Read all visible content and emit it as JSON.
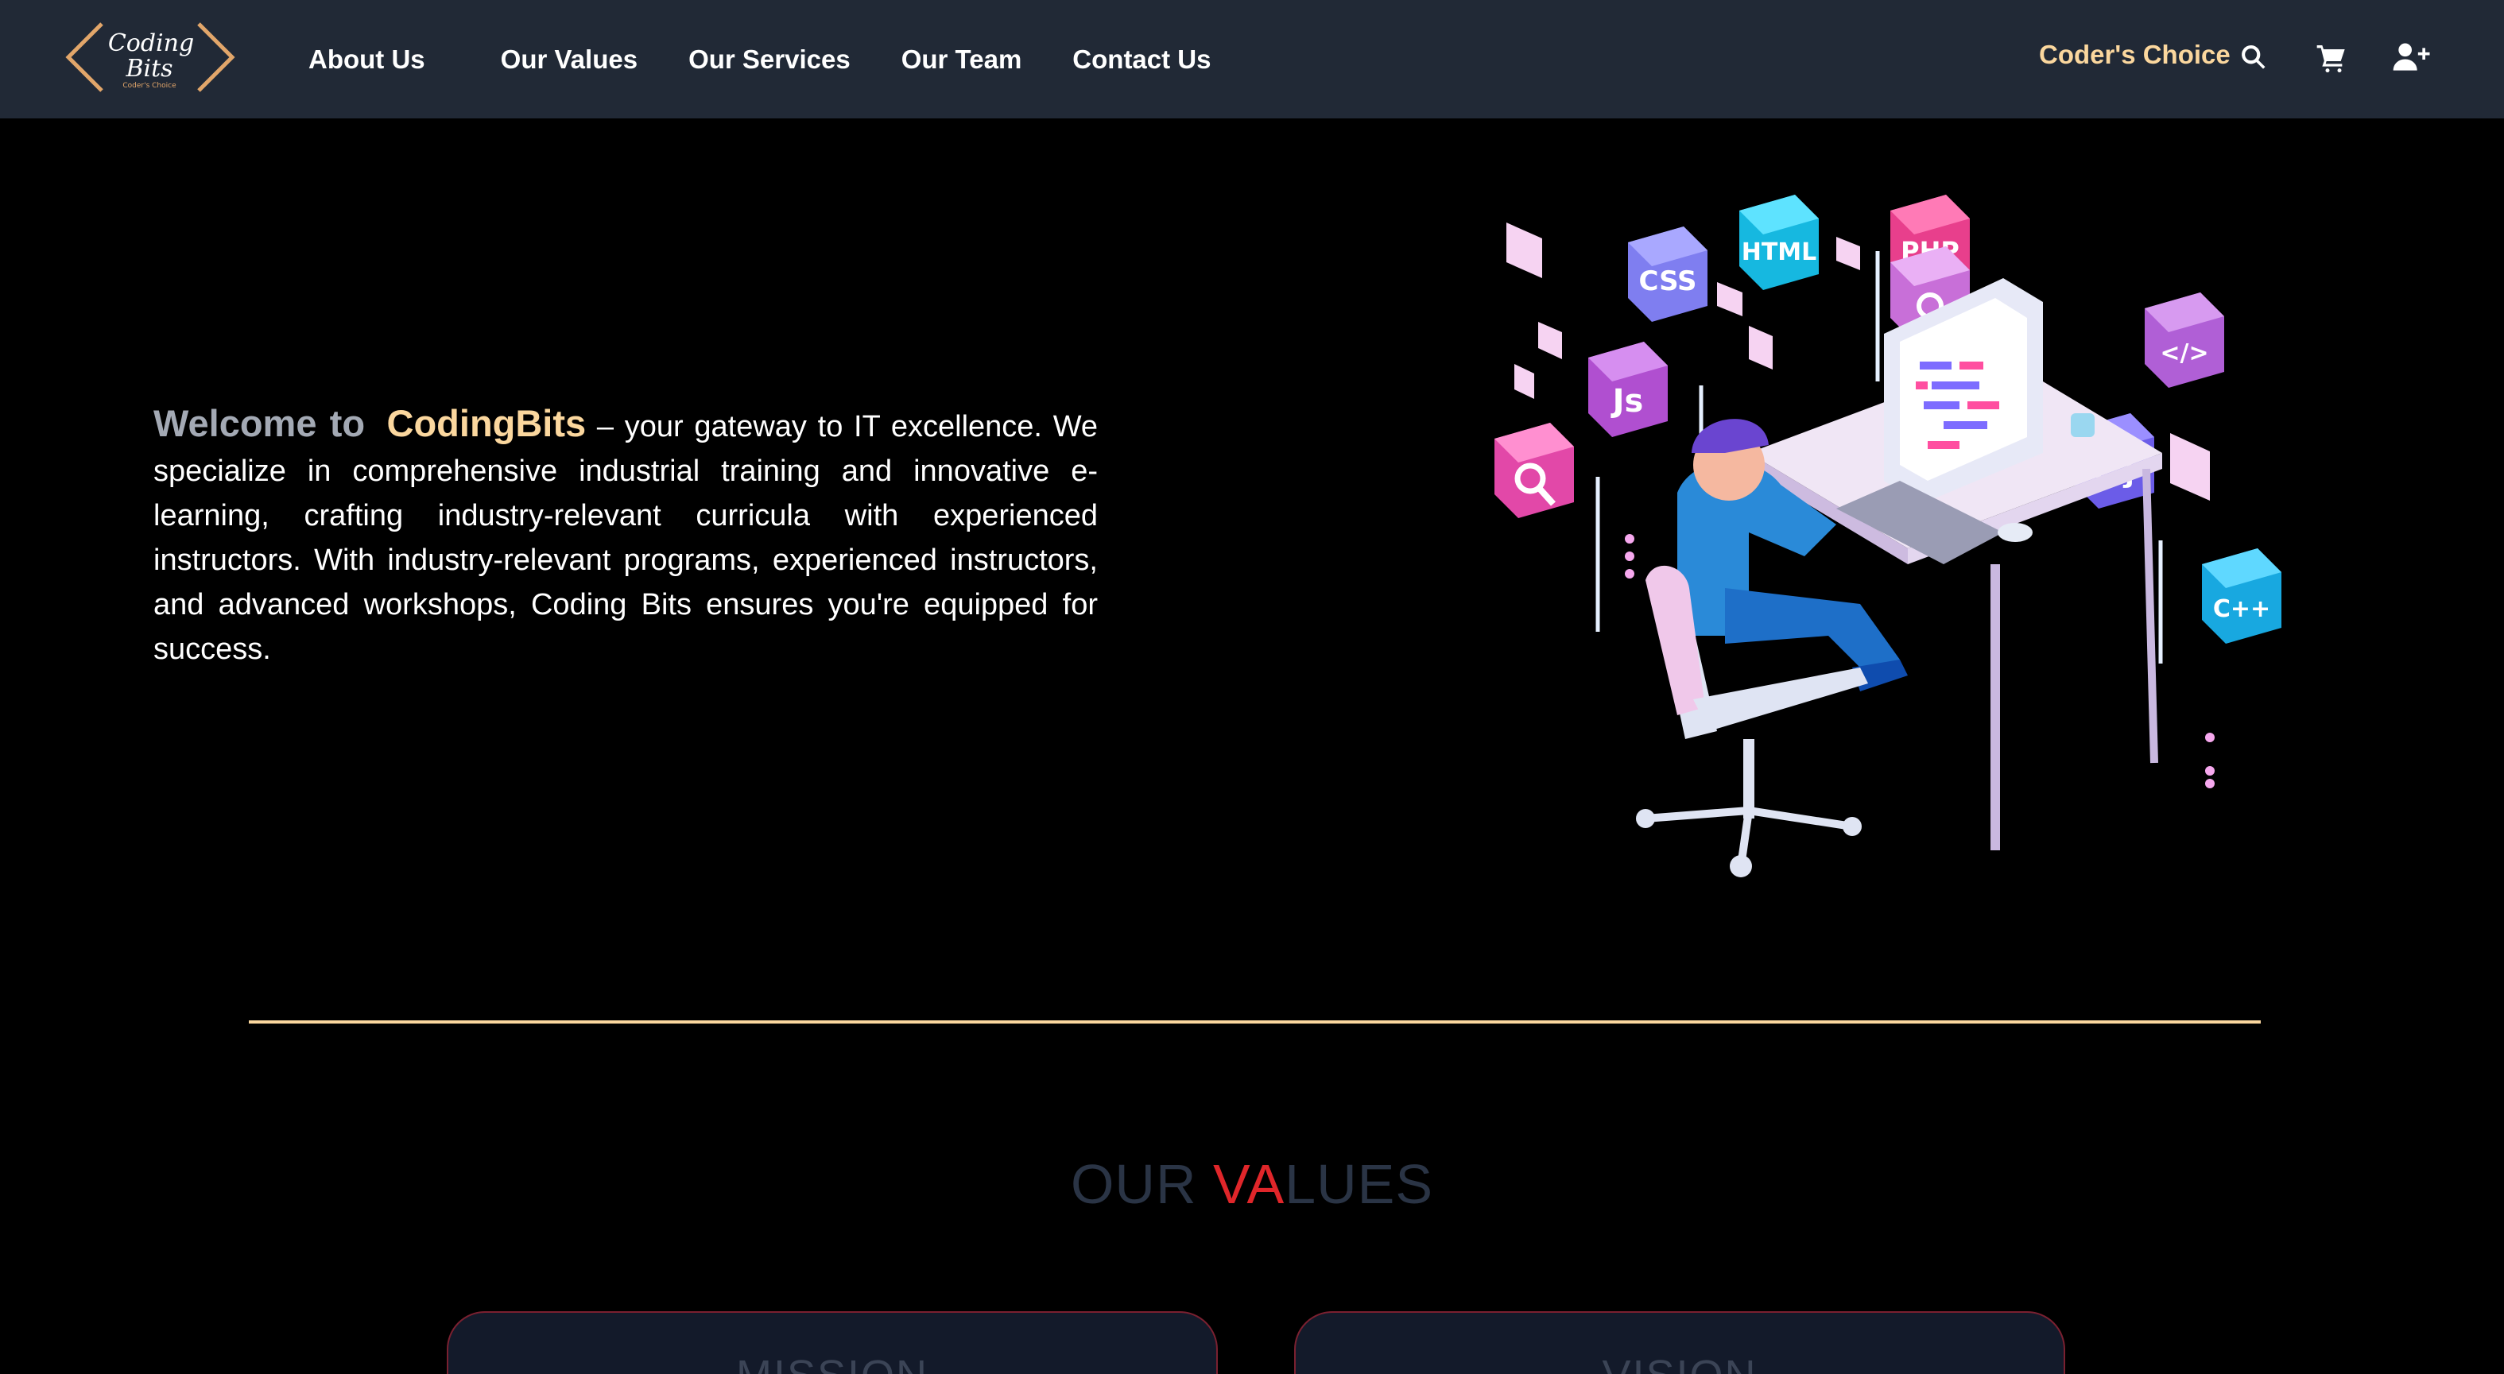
{
  "logo": {
    "line1": "Coding",
    "line2": "Bits",
    "tagline": "Coder's Choice"
  },
  "nav": {
    "links": [
      {
        "label": "About Us"
      },
      {
        "label": "Our Values"
      },
      {
        "label": "Our Services"
      },
      {
        "label": "Our Team"
      },
      {
        "label": "Contact Us"
      }
    ],
    "brand_label": "Coder's Choice",
    "icons": [
      "search-icon",
      "cart-icon",
      "add-user-icon"
    ]
  },
  "hero": {
    "welcome": "Welcome to",
    "brand": "CodingBits",
    "body": " – your gateway to IT excellence. We specialize in comprehensive industrial training and innovative e-learning, crafting industry-relevant curricula with experienced instructors. With industry-relevant programs, experienced instructors, and advanced workshops, Coding Bits ensures you're equipped for success.",
    "illustration_tiles": [
      "CSS",
      "HTML",
      "PHP",
      "Js",
      "{ }",
      "</>",
      "C++"
    ]
  },
  "values": {
    "title_prefix": "OUR ",
    "title_accent": "VA",
    "title_suffix": "LUES",
    "cards": [
      {
        "title": "MISSION"
      },
      {
        "title": "VISION"
      }
    ]
  },
  "colors": {
    "navbar_bg": "#212936",
    "accent_gold": "#fbd79e",
    "accent_red": "#e0262a",
    "page_bg": "#000000"
  }
}
